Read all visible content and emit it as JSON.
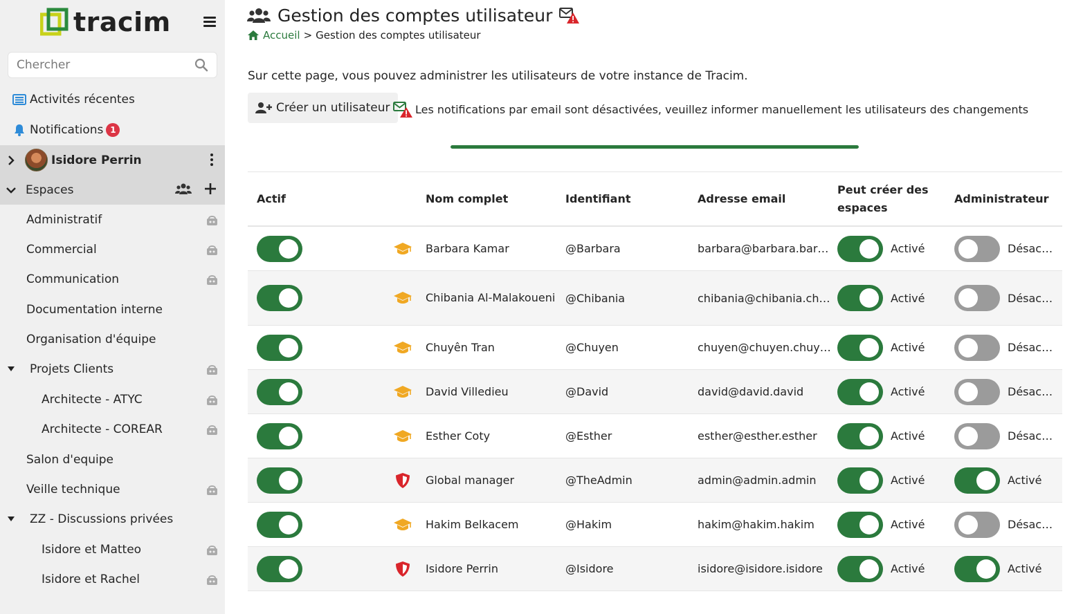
{
  "app": {
    "name": "tracim"
  },
  "sidebar": {
    "search_placeholder": "Chercher",
    "recent": "Activités récentes",
    "notifications": "Notifications",
    "notifications_count": "1",
    "user_name": "Isidore Perrin",
    "spaces_label": "Espaces",
    "spaces": [
      {
        "label": "Administratif",
        "level": 0,
        "locked": true,
        "tree": false
      },
      {
        "label": "Commercial",
        "level": 0,
        "locked": true,
        "tree": false
      },
      {
        "label": "Communication",
        "level": 0,
        "locked": true,
        "tree": false
      },
      {
        "label": "Documentation interne",
        "level": 0,
        "locked": false,
        "tree": false
      },
      {
        "label": "Organisation d'équipe",
        "level": 0,
        "locked": false,
        "tree": false
      },
      {
        "label": "Projets Clients",
        "level": 0,
        "locked": true,
        "tree": true
      },
      {
        "label": "Architecte - ATYC",
        "level": 1,
        "locked": true,
        "tree": false
      },
      {
        "label": "Architecte - COREAR",
        "level": 1,
        "locked": true,
        "tree": false
      },
      {
        "label": "Salon d'equipe",
        "level": 0,
        "locked": false,
        "tree": false
      },
      {
        "label": "Veille technique",
        "level": 0,
        "locked": true,
        "tree": false
      },
      {
        "label": "ZZ - Discussions privées",
        "level": 0,
        "locked": false,
        "tree": true
      },
      {
        "label": "Isidore et Matteo",
        "level": 1,
        "locked": true,
        "tree": false
      },
      {
        "label": "Isidore et Rachel",
        "level": 1,
        "locked": true,
        "tree": false
      }
    ]
  },
  "page": {
    "title": "Gestion des comptes utilisateur",
    "breadcrumb_home": "Accueil",
    "breadcrumb_sep": ">",
    "breadcrumb_current": "Gestion des comptes utilisateur",
    "intro": "Sur cette page, vous pouvez administrer les utilisateurs de votre instance de Tracim.",
    "create_button": "Créer un utilisateur",
    "email_warning": "Les notifications par email sont désactivées, veuillez informer manuellement les utilisateurs des changements",
    "progress": 1.0
  },
  "table": {
    "headers": {
      "active": "Actif",
      "name": "Nom complet",
      "id": "Identifiant",
      "email": "Adresse email",
      "can_create": "Peut créer des espaces",
      "admin": "Administrateur"
    },
    "on_label": "Activé",
    "off_label": "Désactivé",
    "rows": [
      {
        "active": true,
        "role": "graduation-cap-icon",
        "name": "Barbara Kamar",
        "id": "@Barbara",
        "email": "barbara@barbara.barbara",
        "can_create": true,
        "admin": false
      },
      {
        "active": true,
        "role": "graduation-cap-icon",
        "name": "Chibania Al-Malakoueni",
        "id": "@Chibania",
        "email": "chibania@chibania.chibania",
        "can_create": true,
        "admin": false
      },
      {
        "active": true,
        "role": "graduation-cap-icon",
        "name": "Chuyên Tran",
        "id": "@Chuyen",
        "email": "chuyen@chuyen.chuyen",
        "can_create": true,
        "admin": false
      },
      {
        "active": true,
        "role": "graduation-cap-icon",
        "name": "David Villedieu",
        "id": "@David",
        "email": "david@david.david",
        "can_create": true,
        "admin": false
      },
      {
        "active": true,
        "role": "graduation-cap-icon",
        "name": "Esther Coty",
        "id": "@Esther",
        "email": "esther@esther.esther",
        "can_create": true,
        "admin": false
      },
      {
        "active": true,
        "role": "shield-icon",
        "name": "Global manager",
        "id": "@TheAdmin",
        "email": "admin@admin.admin",
        "can_create": true,
        "admin": true
      },
      {
        "active": true,
        "role": "graduation-cap-icon",
        "name": "Hakim Belkacem",
        "id": "@Hakim",
        "email": "hakim@hakim.hakim",
        "can_create": true,
        "admin": false
      },
      {
        "active": true,
        "role": "shield-icon",
        "name": "Isidore Perrin",
        "id": "@Isidore",
        "email": "isidore@isidore.isidore",
        "can_create": true,
        "admin": true
      }
    ]
  },
  "colors": {
    "accent": "#2b7a3d",
    "badge": "#dc3545",
    "role_user": "#f0a823",
    "role_admin": "#d9252b"
  }
}
